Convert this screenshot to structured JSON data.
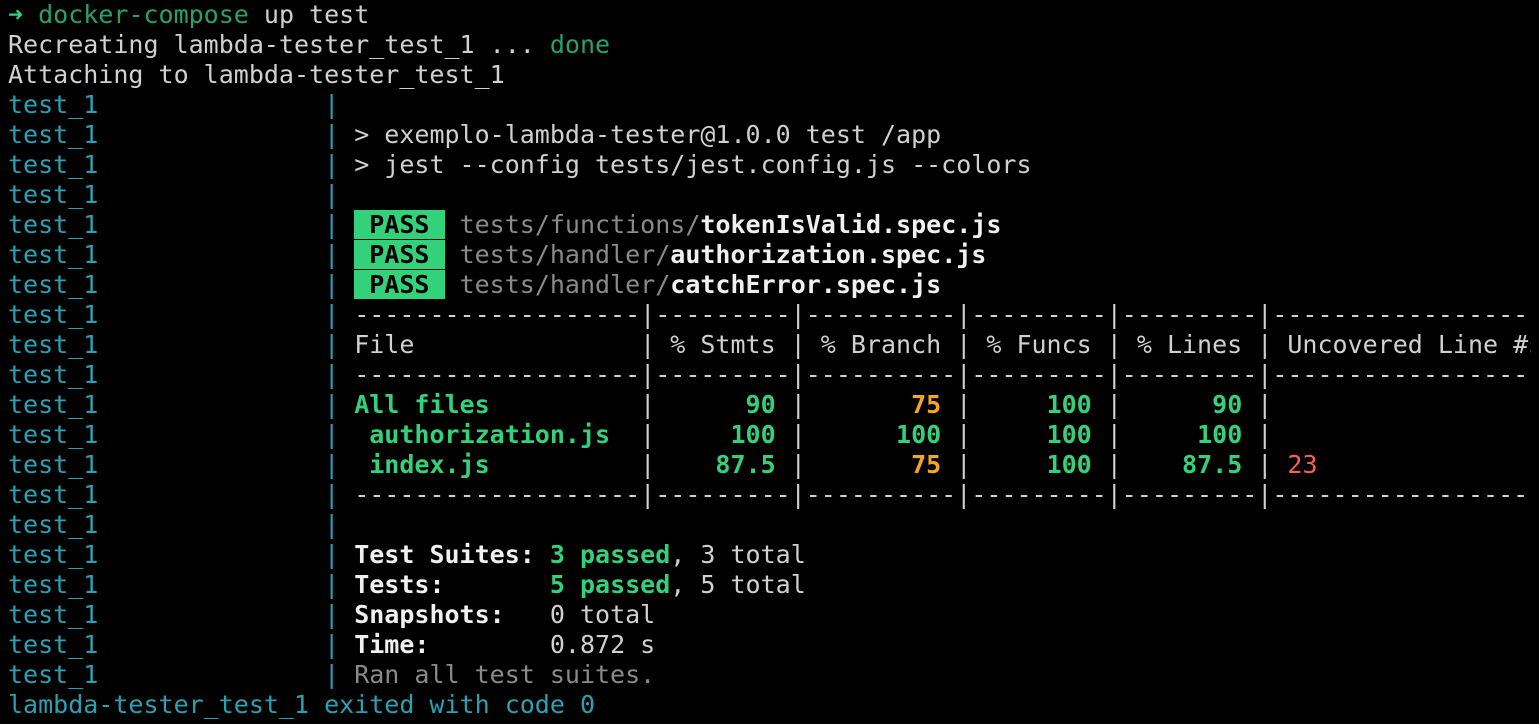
{
  "command": {
    "arrow": "➜",
    "text": " docker-compose",
    "args": " up test"
  },
  "recreating": {
    "text": "Recreating lambda-tester_test_1 ... ",
    "status": "done"
  },
  "attaching": "Attaching to lambda-tester_test_1",
  "prefix": "test_1               | ",
  "npm_lines": [
    "> exemplo-lambda-tester@1.0.0 test /app",
    "> jest --config tests/jest.config.js --colors"
  ],
  "suites": [
    {
      "badge": " PASS ",
      "dir": "tests/functions/",
      "file": "tokenIsValid.spec.js"
    },
    {
      "badge": " PASS ",
      "dir": "tests/handler/",
      "file": "authorization.spec.js"
    },
    {
      "badge": " PASS ",
      "dir": "tests/handler/",
      "file": "catchError.spec.js"
    }
  ],
  "coverage": {
    "separator": "-------------------|---------|----------|---------|---------|-------------------",
    "header": "File               | % Stmts | % Branch | % Funcs | % Lines | Uncovered Line #s ",
    "rows": [
      {
        "file": "All files",
        "indent": "",
        "stmts": "90",
        "branch": "75",
        "funcs": "100",
        "lines": "90",
        "uncovered": ""
      },
      {
        "file": "authorization.js",
        "indent": " ",
        "stmts": "100",
        "branch": "100",
        "funcs": "100",
        "lines": "100",
        "uncovered": ""
      },
      {
        "file": "index.js",
        "indent": " ",
        "stmts": "87.5",
        "branch": "75",
        "funcs": "100",
        "lines": "87.5",
        "uncovered": "23"
      }
    ]
  },
  "summary": {
    "suites_label": "Test Suites: ",
    "suites_passed": "3 passed",
    "suites_total": ", 3 total",
    "tests_label": "Tests:       ",
    "tests_passed": "5 passed",
    "tests_total": ", 5 total",
    "snapshots_label": "Snapshots:   ",
    "snapshots_value": "0 total",
    "time_label": "Time:        ",
    "time_value": "0.872 s",
    "ran": "Ran all test suites."
  },
  "exit_line": "lambda-tester_test_1 exited with code 0",
  "colors": {
    "background": "#000000",
    "prefix": "#2aa1b3",
    "pass": "#33d17a",
    "warn": "#f5a623",
    "error": "#f66151"
  }
}
